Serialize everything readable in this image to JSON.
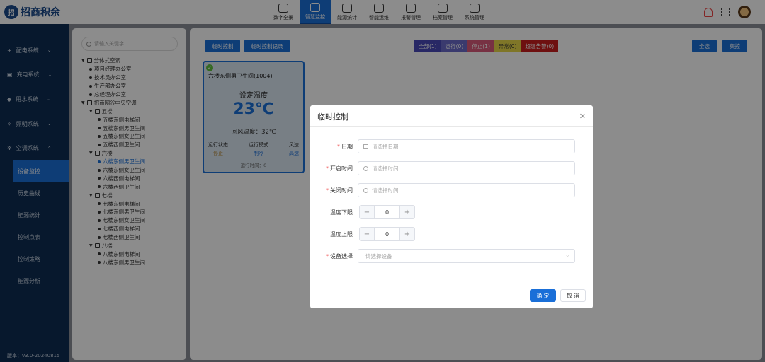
{
  "app": {
    "logo_mark": "招",
    "logo_text": "招商积余"
  },
  "nav": [
    {
      "label": "数字全景",
      "icon": "panorama-icon"
    },
    {
      "label": "智慧监控",
      "icon": "monitor-icon",
      "active": true
    },
    {
      "label": "能源统计",
      "icon": "energy-icon"
    },
    {
      "label": "智能运维",
      "icon": "maintenance-icon"
    },
    {
      "label": "报警管理",
      "icon": "alarm-icon"
    },
    {
      "label": "档案管理",
      "icon": "archive-icon"
    },
    {
      "label": "系统管理",
      "icon": "system-icon"
    }
  ],
  "sidebar": {
    "items": [
      {
        "label": "配电系统",
        "icon": "+"
      },
      {
        "label": "充电系统",
        "icon": "▣"
      },
      {
        "label": "用水系统",
        "icon": "◆"
      },
      {
        "label": "照明系统",
        "icon": "✧"
      },
      {
        "label": "空调系统",
        "icon": "✲"
      }
    ],
    "subitems": [
      "设备监控",
      "历史曲线",
      "能源统计",
      "控制点表",
      "控制策略",
      "能源分析"
    ],
    "version": "版本：v3.0-20240815"
  },
  "tree": {
    "search_placeholder": "请输入关键字",
    "rows": [
      {
        "level": 0,
        "type": "group",
        "label": "分体式空调"
      },
      {
        "level": 1,
        "type": "leaf",
        "label": "项目经理办公室"
      },
      {
        "level": 1,
        "type": "leaf",
        "label": "技术员办公室"
      },
      {
        "level": 1,
        "type": "leaf",
        "label": "生产部办公室"
      },
      {
        "level": 1,
        "type": "leaf",
        "label": "总经理办公室"
      },
      {
        "level": 0,
        "type": "group",
        "label": "招商网谷中央空调"
      },
      {
        "level": 1,
        "type": "group",
        "label": "五楼"
      },
      {
        "level": 2,
        "type": "leaf",
        "label": "五楼东侧电梯间"
      },
      {
        "level": 2,
        "type": "leaf",
        "label": "五楼东侧男卫生间"
      },
      {
        "level": 2,
        "type": "leaf",
        "label": "五楼东侧女卫生间"
      },
      {
        "level": 2,
        "type": "leaf",
        "label": "五楼西侧卫生间"
      },
      {
        "level": 1,
        "type": "group",
        "label": "六楼"
      },
      {
        "level": 2,
        "type": "leaf",
        "label": "六楼东侧男卫生间",
        "selected": true
      },
      {
        "level": 2,
        "type": "leaf",
        "label": "六楼东侧女卫生间"
      },
      {
        "level": 2,
        "type": "leaf",
        "label": "六楼西侧电梯间"
      },
      {
        "level": 2,
        "type": "leaf",
        "label": "六楼西侧卫生间"
      },
      {
        "level": 1,
        "type": "group",
        "label": "七楼"
      },
      {
        "level": 2,
        "type": "leaf",
        "label": "七楼东侧电梯间"
      },
      {
        "level": 2,
        "type": "leaf",
        "label": "七楼东侧男卫生间"
      },
      {
        "level": 2,
        "type": "leaf",
        "label": "七楼东侧女卫生间"
      },
      {
        "level": 2,
        "type": "leaf",
        "label": "七楼西侧电梯间"
      },
      {
        "level": 2,
        "type": "leaf",
        "label": "七楼西侧卫生间"
      },
      {
        "level": 1,
        "type": "group",
        "label": "八楼"
      },
      {
        "level": 2,
        "type": "leaf",
        "label": "八楼东侧电梯间"
      },
      {
        "level": 2,
        "type": "leaf",
        "label": "八楼东侧男卫生间"
      }
    ]
  },
  "toolbar": {
    "temp_control": "临时控制",
    "temp_control_record": "临时控制记录",
    "filters": [
      {
        "label": "全部(1)",
        "color": "#4a4ab8"
      },
      {
        "label": "运行(0)",
        "color": "#6a6ac8"
      },
      {
        "label": "停止(1)",
        "color": "#d95a7a"
      },
      {
        "label": "异常(0)",
        "color": "#e8d84a"
      },
      {
        "label": "超温告警(0)",
        "color": "#c81e1e"
      }
    ],
    "select_all": "全选",
    "group_control": "集控"
  },
  "device": {
    "title": "六楼东侧男卫生间(1004)",
    "set_label": "设定温度",
    "set_temp": "23℃",
    "return_temp": "回风温度：32℃",
    "stats": [
      {
        "label": "运行状态",
        "value": "停止",
        "kind": "stop"
      },
      {
        "label": "运行模式",
        "value": "制冷",
        "kind": "mode"
      },
      {
        "label": "风速",
        "value": "高速",
        "kind": "speed"
      }
    ],
    "runtime": "运行时间：0"
  },
  "modal": {
    "title": "临时控制",
    "fields": {
      "date": {
        "label": "日期",
        "placeholder": "请选择日期"
      },
      "start": {
        "label": "开启时间",
        "placeholder": "请选择时间"
      },
      "end": {
        "label": "关闭时间",
        "placeholder": "请选择时间"
      },
      "tmin": {
        "label": "温度下限",
        "value": "0"
      },
      "tmax": {
        "label": "温度上限",
        "value": "0"
      },
      "device": {
        "label": "设备选择",
        "placeholder": "请选择设备"
      }
    },
    "confirm": "确 定",
    "cancel": "取 消"
  }
}
